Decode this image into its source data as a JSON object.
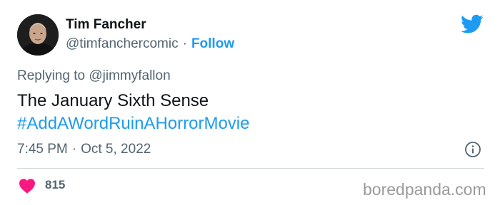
{
  "author": {
    "name": "Tim Fancher",
    "handle": "@timfanchercomic",
    "separator": "·",
    "follow_label": "Follow",
    "avatar_icon": "avatar-photo"
  },
  "brand": {
    "icon": "twitter-bird-icon",
    "color": "#1d9bf0"
  },
  "reply": {
    "prefix": "Replying to",
    "mention": "@jimmyfallon"
  },
  "tweet": {
    "text_line": "The January Sixth Sense",
    "hashtag": "#AddAWordRuinAHorrorMovie"
  },
  "meta": {
    "time": "7:45 PM",
    "separator": "·",
    "date": "Oct 5, 2022",
    "info_icon": "info-icon"
  },
  "engagement": {
    "like_icon": "heart-icon",
    "like_color": "#f91880",
    "likes": "815"
  },
  "watermark": {
    "text": "boredpanda.com"
  }
}
